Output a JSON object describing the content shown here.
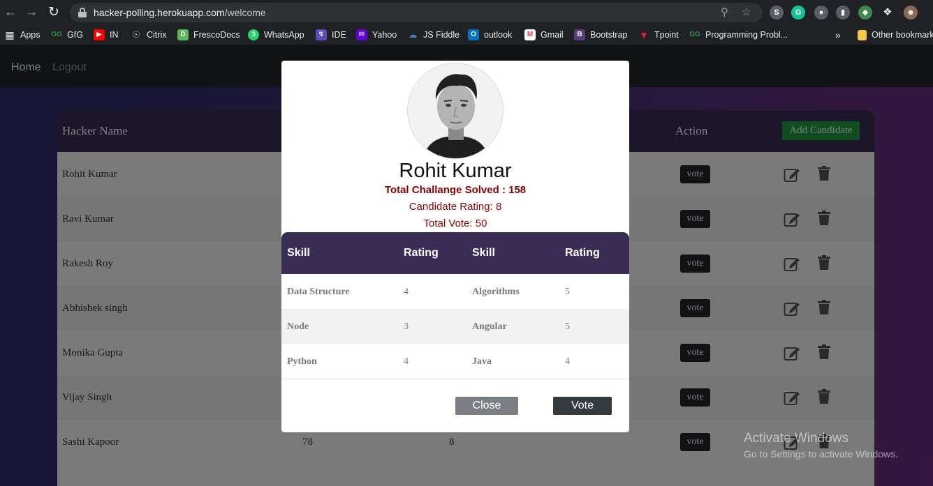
{
  "browser": {
    "url_host": "hacker-polling.herokuapp.com",
    "url_path": "/welcome",
    "bookmarks": [
      {
        "label": "Apps",
        "icon": "apps-grid-icon",
        "color": "#e8eaed"
      },
      {
        "label": "GfG",
        "icon": "gfg-icon",
        "color": "#2f8d46"
      },
      {
        "label": "IN",
        "icon": "youtube-icon",
        "color": "#ff0000"
      },
      {
        "label": "Citrix",
        "icon": "citrix-icon",
        "color": "#9aa0a6"
      },
      {
        "label": "FrescoDocs",
        "icon": "frescodocs-icon",
        "color": "#5cb85c"
      },
      {
        "label": "WhatsApp",
        "icon": "whatsapp-icon",
        "color": "#25d366"
      },
      {
        "label": "IDE",
        "icon": "ide-icon",
        "color": "#5f4bb6"
      },
      {
        "label": "Yahoo",
        "icon": "yahoo-icon",
        "color": "#6001d2"
      },
      {
        "label": "JS Fiddle",
        "icon": "jsfiddle-icon",
        "color": "#4679bd"
      },
      {
        "label": "outlook",
        "icon": "outlook-icon",
        "color": "#0072c6"
      },
      {
        "label": "Gmail",
        "icon": "gmail-icon",
        "color": "#ea4335"
      },
      {
        "label": "Bootstrap",
        "icon": "bootstrap-icon",
        "color": "#563d7c"
      },
      {
        "label": "Tpoint",
        "icon": "tpoint-icon",
        "color": "#e0222a"
      },
      {
        "label": "Programming Probl...",
        "icon": "gfg-icon",
        "color": "#2f8d46"
      }
    ],
    "other_bookmarks": "Other bookmarks"
  },
  "nav": {
    "home": "Home",
    "logout": "Logout"
  },
  "table": {
    "headers": {
      "name": "Hacker Name",
      "action": "Action"
    },
    "add_button": "Add Candidate",
    "vote_label": "vote",
    "rows": [
      {
        "name": "Rohit Kumar",
        "col2": "",
        "col3": ""
      },
      {
        "name": "Ravi Kumar",
        "col2": "",
        "col3": ""
      },
      {
        "name": "Rakesh Roy",
        "col2": "",
        "col3": ""
      },
      {
        "name": "Abhishek singh",
        "col2": "",
        "col3": ""
      },
      {
        "name": "Monika Gupta",
        "col2": "",
        "col3": ""
      },
      {
        "name": "Vijay Singh",
        "col2": "",
        "col3": ""
      },
      {
        "name": "Sashi Kapoor",
        "col2": "78",
        "col3": "8"
      }
    ]
  },
  "modal": {
    "name": "Rohit Kumar",
    "solved": "Total Challange Solved : 158",
    "rating": "Candidate Rating: 8",
    "votes": "Total Vote: 50",
    "skill_headers": [
      "Skill",
      "Rating",
      "Skill",
      "Rating"
    ],
    "skills": [
      {
        "skill1": "Data Structure",
        "rating1": "4",
        "skill2": "Algorithms",
        "rating2": "5"
      },
      {
        "skill1": "Node",
        "rating1": "3",
        "skill2": "Angular",
        "rating2": "5"
      },
      {
        "skill1": "Python",
        "rating1": "4",
        "skill2": "Java",
        "rating2": "4"
      }
    ],
    "close_label": "Close",
    "vote_label": "Vote"
  },
  "watermark": {
    "title": "Activate Windows",
    "subtitle": "Go to Settings to activate Windows."
  },
  "colors": {
    "table_header": "#3a2d55",
    "add_button": "#1f9d3f",
    "modal_text_accent": "#8b0000"
  }
}
